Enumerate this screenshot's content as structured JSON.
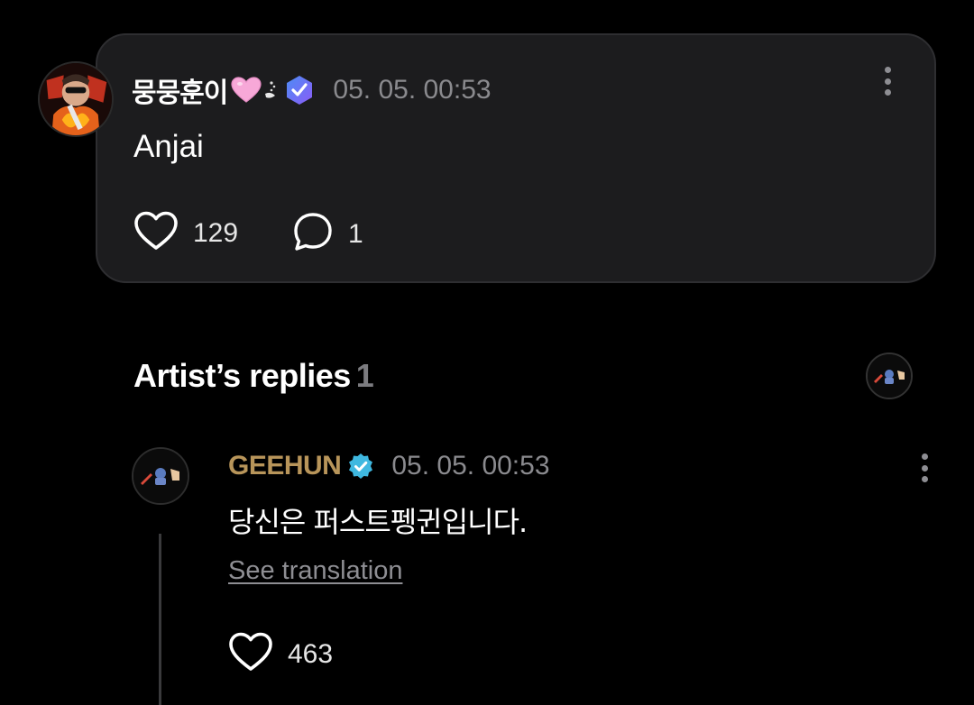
{
  "post": {
    "username": "뭉뭉훈이",
    "timestamp": "05. 05. 00:53",
    "body": "Anjai",
    "likes": "129",
    "comments": "1",
    "accent_badge_color": "#6b5cf6",
    "heart_emoji_color": "#f7a8d8"
  },
  "replies_section": {
    "title": "Artist’s replies",
    "count": "1"
  },
  "reply": {
    "username": "GEEHUN",
    "name_color": "#b8955a",
    "verified_color": "#3fb8e0",
    "timestamp": "05. 05. 00:53",
    "text": "당신은 퍼스트펭귄입니다.",
    "translate_label": "See translation",
    "likes": "463"
  },
  "icons": [
    "user-avatar",
    "heart-emoji",
    "sparkle-emoji",
    "membership-badge-icon",
    "more-vertical-icon",
    "heart-outline-icon",
    "comment-bubble-icon",
    "artist-avatar",
    "verified-check-icon"
  ]
}
